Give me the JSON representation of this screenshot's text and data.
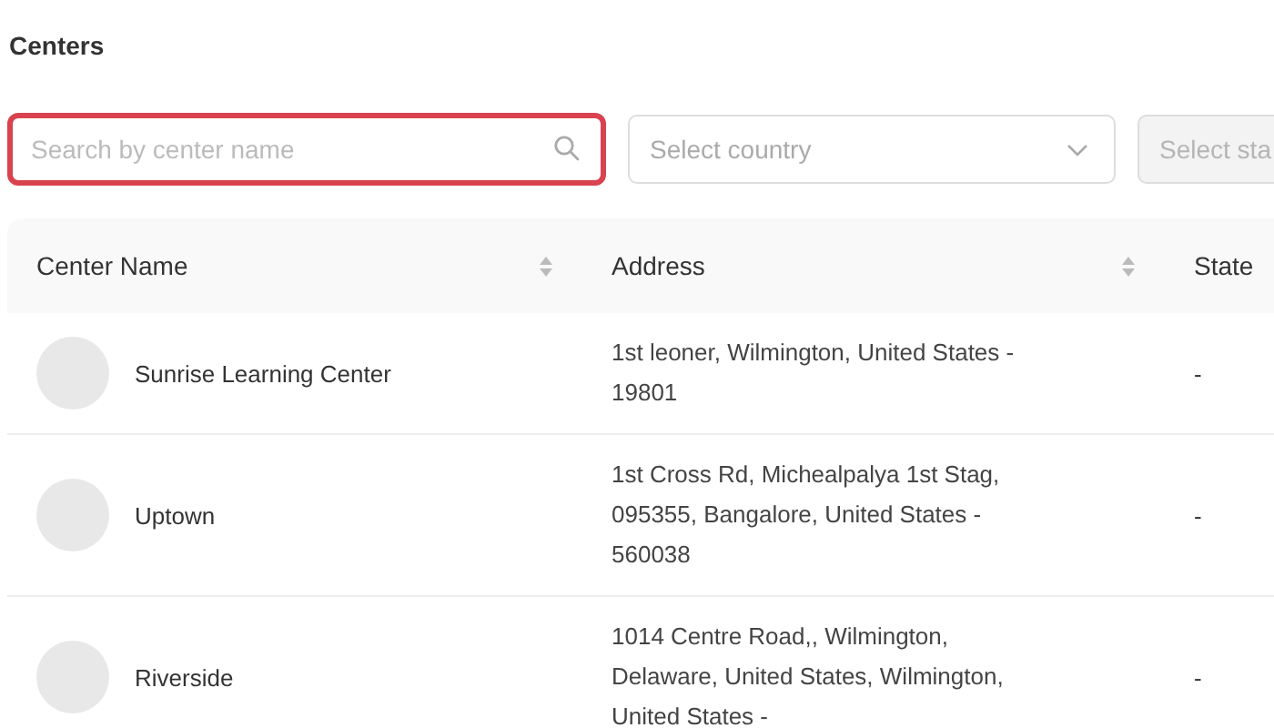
{
  "page": {
    "title": "Centers"
  },
  "filters": {
    "search": {
      "placeholder": "Search by center name",
      "focused": true
    },
    "selects": [
      {
        "placeholder": "Select country",
        "disabled": false
      },
      {
        "placeholder": "Select sta",
        "disabled": true
      }
    ]
  },
  "table": {
    "columns": [
      {
        "label": "Center Name",
        "sortable": true
      },
      {
        "label": "Address",
        "sortable": true
      },
      {
        "label": "State",
        "sortable": false
      }
    ],
    "rows": [
      {
        "name": "Sunrise Learning Center",
        "address": "1st leoner, Wilmington, United States - 19801",
        "state": "-"
      },
      {
        "name": "Uptown",
        "address": "1st Cross Rd, Michealpalya 1st Stag, 095355, Bangalore, United States - 560038",
        "state": "-"
      },
      {
        "name": "Riverside",
        "address": "1014 Centre Road,, Wilmington, Delaware, United States, Wilmington, United States -",
        "state": "-"
      }
    ]
  }
}
